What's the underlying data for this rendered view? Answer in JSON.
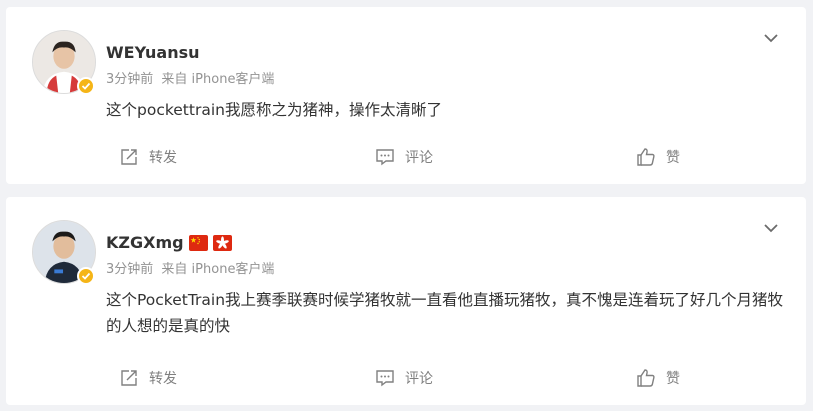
{
  "posts": [
    {
      "username": "WEYuansu",
      "flags": [],
      "time": "3分钟前",
      "source": "来自 iPhone客户端",
      "text": "这个pockettrain我愿称之为猪神，操作太清晰了",
      "repost_label": "转发",
      "comment_label": "评论",
      "like_label": "赞"
    },
    {
      "username": "KZGXmg",
      "flags": [
        "china-flag-icon",
        "hongkong-flag-icon"
      ],
      "time": "3分钟前",
      "source": "来自 iPhone客户端",
      "text": "这个PocketTrain我上赛季联赛时候学猪牧就一直看他直播玩猪牧，真不愧是连着玩了好几个月猪牧的人想的是真的快",
      "repost_label": "转发",
      "comment_label": "评论",
      "like_label": "赞"
    }
  ],
  "colors": {
    "background": "#f1f2f5",
    "card": "#ffffff",
    "meta_text": "#939393",
    "action_text": "#808080",
    "verified_badge": "#f5b517"
  }
}
